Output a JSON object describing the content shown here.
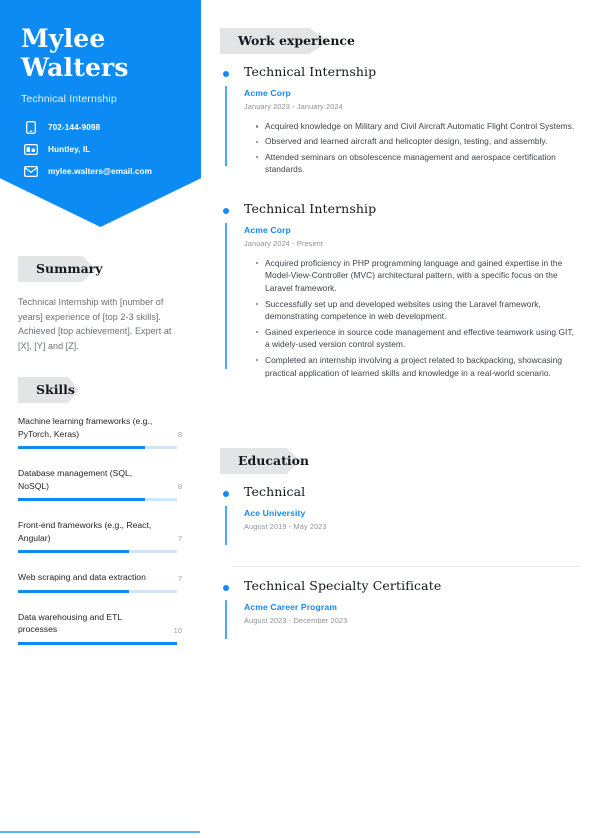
{
  "profile": {
    "first_name": "Mylee",
    "last_name": "Walters",
    "job_title": "Technical Internship"
  },
  "contact": {
    "items": [
      {
        "icon": "phone-icon",
        "value": "702-144-9098"
      },
      {
        "icon": "location-icon",
        "value": "Huntley, IL"
      },
      {
        "icon": "email-icon",
        "value": "mylee.walters@email.com"
      }
    ]
  },
  "summary": {
    "heading": "Summary",
    "text": "Technical Internship with [number of years] experience of [top 2-3 skills]. Achieved [top achievement]. Expert at [X], [Y] and [Z]."
  },
  "skills": {
    "heading": "Skills",
    "max_level": 10,
    "items": [
      {
        "name": "Machine learning frameworks (e.g., PyTorch, Keras)",
        "level": "8",
        "percent": 80
      },
      {
        "name": "Database management (SQL, NoSQL)",
        "level": "8",
        "percent": 80
      },
      {
        "name": "Front-end frameworks (e.g., React, Angular)",
        "level": "7",
        "percent": 70
      },
      {
        "name": "Web scraping and data extraction",
        "level": "7",
        "percent": 70
      },
      {
        "name": "Data warehousing and ETL processes",
        "level": "10",
        "percent": 100
      }
    ]
  },
  "work_experience": {
    "heading": "Work experience",
    "entries": [
      {
        "role": "Technical Internship",
        "organization": "Acme Corp",
        "dates": "January 2023 - January 2024",
        "bullets": [
          "Acquired knowledge on Military and Civil Aircraft Automatic Flight Control Systems.",
          "Observed and learned aircraft and helicopter design, testing, and assembly.",
          "Attended seminars on obsolescence management and aerospace certification standards."
        ]
      },
      {
        "role": "Technical Internship",
        "organization": "Acme Corp",
        "dates": "January 2024 - Present",
        "bullets": [
          "Acquired proficiency in PHP programming language and gained expertise in the Model-View-Controller (MVC) architectural pattern, with a specific focus on the Laravel framework.",
          "Successfully set up and developed websites using the Laravel framework, demonstrating competence in web development.",
          "Gained experience in source code management and effective teamwork using GIT, a widely-used version control system.",
          "Completed an internship involving a project related to backpacking, showcasing practical application of learned skills and knowledge in a real-world scenario."
        ]
      }
    ]
  },
  "education": {
    "heading": "Education",
    "entries": [
      {
        "role": "Technical",
        "organization": "Ace University",
        "dates": "August 2019 - May 2023",
        "bullets": []
      },
      {
        "role": "Technical Specialty Certificate",
        "organization": "Acme Career Program",
        "dates": "August 2023 - December 2023",
        "bullets": []
      }
    ]
  },
  "theme": {
    "accent": "#0d8bf5",
    "accent_light": "#cfe6fb",
    "tag_gray": "#e2e4e6",
    "text_dark": "#12181e",
    "text_muted": "#6b7178"
  }
}
